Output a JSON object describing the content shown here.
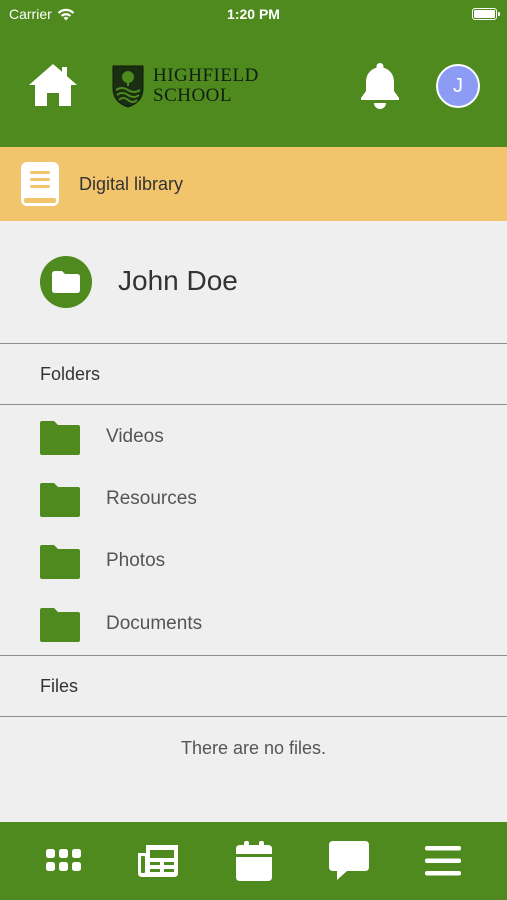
{
  "status_bar": {
    "carrier": "Carrier",
    "time": "1:20 PM"
  },
  "header": {
    "logo_line1": "HIGHFIELD",
    "logo_line2": "SCHOOL",
    "avatar_initial": "J",
    "icons": [
      "home-icon",
      "bell-icon"
    ],
    "colors": {
      "header_bg": "#4e8a1e",
      "avatar_bg": "#8c9cf4"
    }
  },
  "section_banner": {
    "label": "Digital library",
    "icon": "book-icon",
    "color": "#f2c46c"
  },
  "owner": {
    "name": "John Doe",
    "icon": "folder-icon"
  },
  "folders": {
    "heading": "Folders",
    "items": [
      {
        "label": "Videos"
      },
      {
        "label": "Resources"
      },
      {
        "label": "Photos"
      },
      {
        "label": "Documents"
      }
    ]
  },
  "files": {
    "heading": "Files",
    "empty_message": "There are no files."
  },
  "tab_bar": {
    "tabs": [
      "apps-grid-icon",
      "newspaper-icon",
      "calendar-icon",
      "chat-icon",
      "menu-icon"
    ]
  }
}
